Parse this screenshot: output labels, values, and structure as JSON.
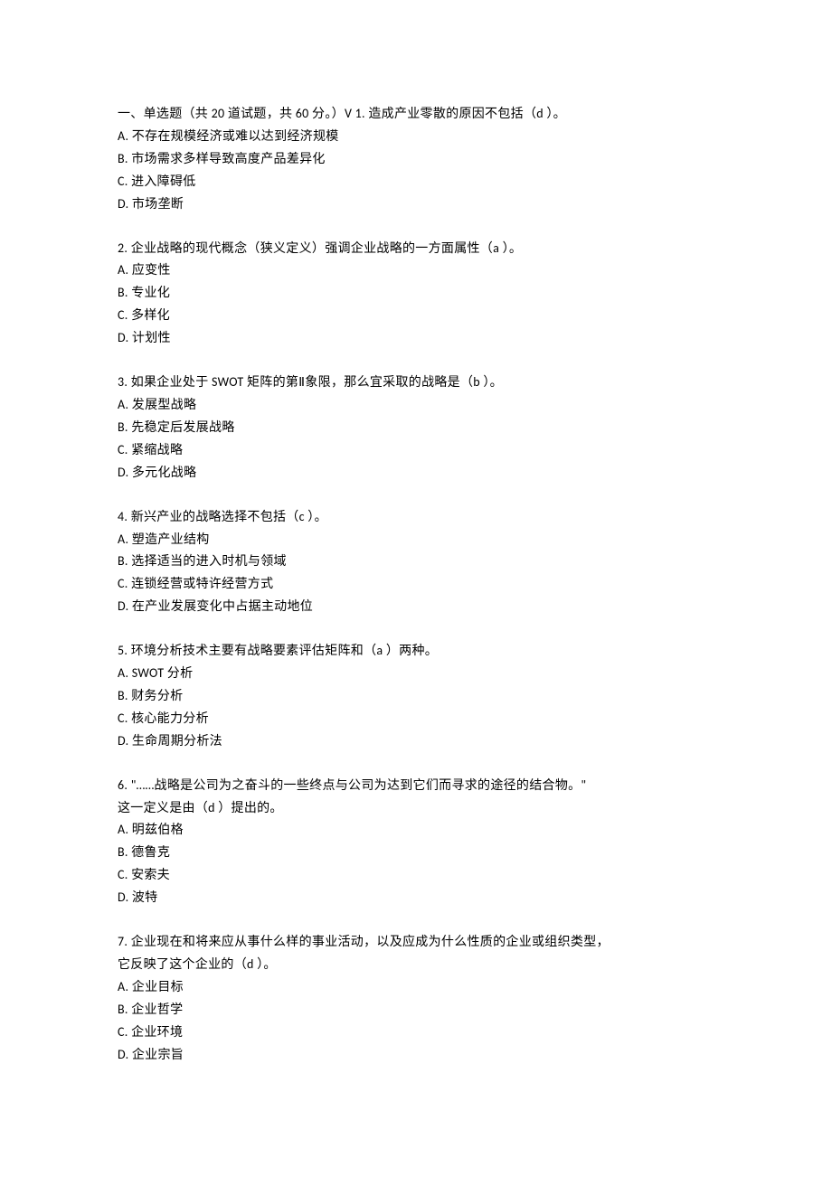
{
  "header": "一、单选题（共 20 道试题，共 60 分。）V 1.   造成产业零散的原因不包括（d ）。",
  "q1": {
    "a": "A.  不存在规模经济或难以达到经济规模",
    "b": "B.  市场需求多样导致高度产品差异化",
    "c": "C.  进入障碍低",
    "d": "D.  市场垄断"
  },
  "q2": {
    "stem": "2.   企业战略的现代概念（狭义定义）强调企业战略的一方面属性（a ）。",
    "a": "A.  应变性",
    "b": "B.  专业化",
    "c": "C.  多样化",
    "d": "D.  计划性"
  },
  "q3": {
    "stem": "3.   如果企业处于 SWOT 矩阵的第Ⅱ象限，那么宜采取的战略是（b ）。",
    "a": "A.  发展型战略",
    "b": "B.  先稳定后发展战略",
    "c": "C.  紧缩战略",
    "d": "D.  多元化战略"
  },
  "q4": {
    "stem": "4.   新兴产业的战略选择不包括（c ）。",
    "a": "A.  塑造产业结构",
    "b": "B.  选择适当的进入时机与领域",
    "c": "C.  连锁经营或特许经营方式",
    "d": "D.  在产业发展变化中占据主动地位"
  },
  "q5": {
    "stem": "5.   环境分析技术主要有战略要素评估矩阵和（a ）两种。",
    "a": "A. SWOT 分析",
    "b": "B.  财务分析",
    "c": "C.  核心能力分析",
    "d": "D.  生命周期分析法"
  },
  "q6": {
    "stem1": "6.    \"……战略是公司为之奋斗的一些终点与公司为达到它们而寻求的途径的结合物。\"",
    "stem2": "这一定义是由（d ）提出的。",
    "a": "A.  明兹伯格",
    "b": "B.  德鲁克",
    "c": "C.  安索夫",
    "d": "D.  波特"
  },
  "q7": {
    "stem1": "7.   企业现在和将来应从事什么样的事业活动，以及应成为什么性质的企业或组织类型，",
    "stem2": "它反映了这个企业的（d ）。",
    "a": "A.  企业目标",
    "b": "B.  企业哲学",
    "c": "C.  企业环境",
    "d": "D.  企业宗旨"
  }
}
